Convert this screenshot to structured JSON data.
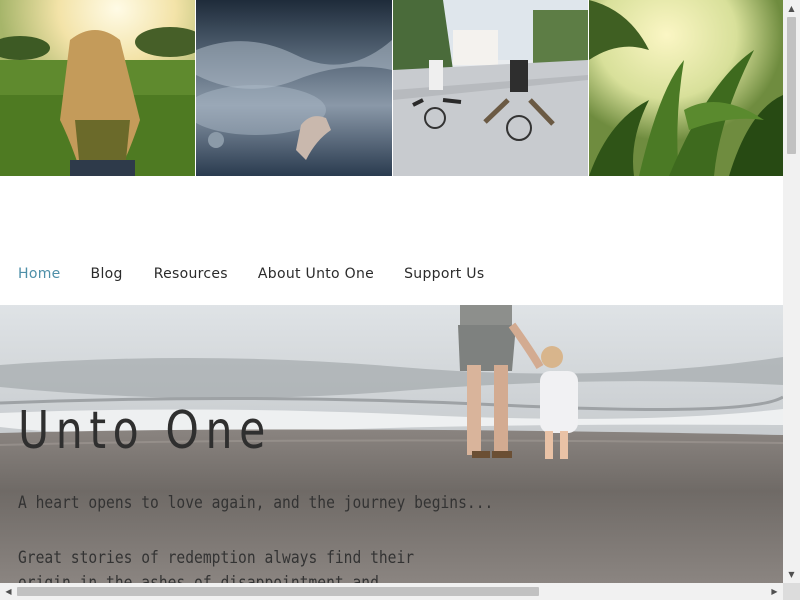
{
  "nav": {
    "items": [
      {
        "label": "Home",
        "active": true
      },
      {
        "label": "Blog",
        "active": false
      },
      {
        "label": "Resources",
        "active": false
      },
      {
        "label": "About Unto One",
        "active": false
      },
      {
        "label": "Support Us",
        "active": false
      }
    ]
  },
  "hero": {
    "title": "Unto One",
    "subtitle": "A heart opens to love again, and the journey begins...",
    "body": "Great stories of redemption always find their origin in the ashes of disappointment and shattered hope."
  },
  "colors": {
    "nav_active": "#4e8fa8",
    "text": "#2f2f2f",
    "scrollbar_track": "#f1f1f1",
    "scrollbar_thumb": "#c1c1c1"
  },
  "icons": {
    "scroll_up": "triangle-up-icon",
    "scroll_down": "triangle-down-icon",
    "scroll_left": "triangle-left-icon",
    "scroll_right": "triangle-right-icon"
  }
}
